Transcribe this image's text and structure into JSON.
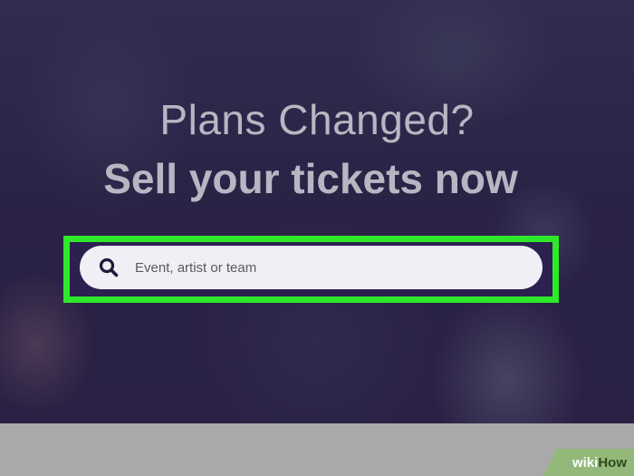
{
  "hero": {
    "headline_line1": "Plans Changed?",
    "headline_line2": "Sell your tickets now"
  },
  "search": {
    "placeholder": "Event, artist or team",
    "icon": "search-icon"
  },
  "highlight": {
    "color": "#2ee82a"
  },
  "watermark": {
    "wiki": "wiki",
    "how": "How"
  },
  "colors": {
    "headline": "#b9b6c3",
    "search_bg": "#f1eff6",
    "footer": "#a9a9a9"
  }
}
